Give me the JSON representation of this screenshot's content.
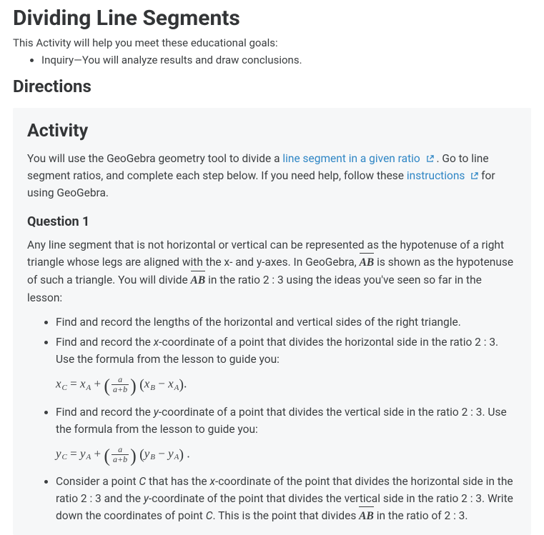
{
  "title": "Dividing Line Segments",
  "lead": "This Activity will help you meet these educational goals:",
  "goals": [
    "Inquiry—You will analyze results and draw conclusions."
  ],
  "directionsHeading": "Directions",
  "activity": {
    "heading": "Activity",
    "intro1a": "You will use the GeoGebra geometry tool to divide a ",
    "link1": "line segment in a given ratio",
    "intro1b": " . Go to line segment ratios, and complete each step below. If you need help, follow these ",
    "link2": "instructions",
    "intro1c": " for using GeoGebra."
  },
  "question": {
    "heading": "Question 1",
    "para_a": "Any line segment that is not horizontal or vertical can be represented as the hypotenuse of a right triangle whose legs are aligned with the x- and y-axes. In GeoGebra, ",
    "seg1": "AB",
    "para_b": " is shown as the hypotenuse of such a triangle. You will divide ",
    "seg2": "AB",
    "para_c": " in the ratio 2 : 3 using the ideas you've seen so far in the lesson:",
    "steps": {
      "s1": "Find and record the lengths of the horizontal and vertical sides of the right triangle.",
      "s2a": "Find and record the ",
      "s2b": "-coordinate of a point that divides the horizontal side in the ratio 2 : 3. Use the formula from the lesson to guide you:",
      "s3a": "Find and record the ",
      "s3b": "-coordinate of a point that divides the vertical side in the ratio 2 : 3. Use the formula from the lesson to guide you:",
      "s4a": "Consider a point ",
      "s4b": " that has the ",
      "s4c": "-coordinate of the point that divides the horizontal side in the ratio 2 : 3 and the ",
      "s4d": "-coordinate of the point that divides the vertical side in the ratio 2 : 3. Write down the coordinates of point ",
      "s4e": ". This is the point that divides ",
      "seg3": "AB",
      "s4f": " in the ratio of 2 : 3."
    },
    "vars": {
      "x": "x",
      "y": "y",
      "C": "C",
      "A": "A",
      "B": "B",
      "a": "a",
      "aplusb": "a+b"
    }
  }
}
